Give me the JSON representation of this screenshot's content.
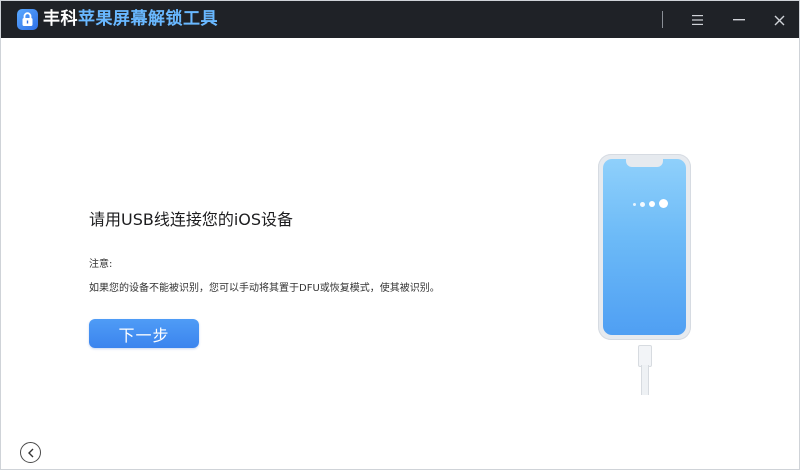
{
  "window": {
    "title_brand": "丰科",
    "title_product": "苹果屏幕解锁工具"
  },
  "titlebar": {
    "icons": [
      "lock-icon",
      "menu-icon",
      "minimize-icon",
      "close-icon"
    ]
  },
  "main": {
    "heading": "请用USB线连接您的iOS设备",
    "note_label": "注意:",
    "note_text": "如果您的设备不能被识别，您可以手动将其置于DFU或恢复模式，使其被识别。",
    "next_button": "下一步"
  },
  "illustration": {
    "name": "phone-with-usb-cable"
  },
  "footer": {
    "back_icon": "chevron-left-icon"
  },
  "colors": {
    "titlebar": "#1f2227",
    "product_title": "#69b8ff",
    "button": "#4a90f0",
    "screen": "#6cbaf7"
  }
}
